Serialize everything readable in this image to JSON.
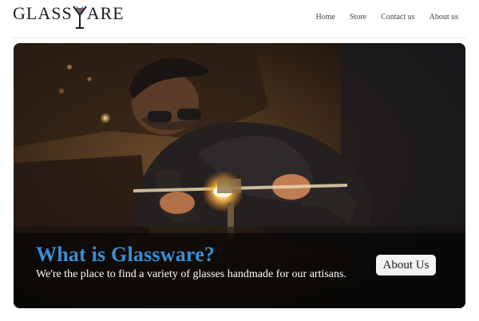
{
  "brand": {
    "logo_left": "GLASS",
    "logo_right": "ARE"
  },
  "nav": {
    "items": [
      "Home",
      "Store",
      "Contact us",
      "About us"
    ]
  },
  "hero": {
    "title": "What is Glassware?",
    "subtitle": "We're the place to find a variety of glasses handmade for our artisans.",
    "button_label": "About Us"
  },
  "colors": {
    "title_accent": "#3a8ed2",
    "text": "#1d1d1d",
    "button_bg": "#f3f3f3"
  }
}
